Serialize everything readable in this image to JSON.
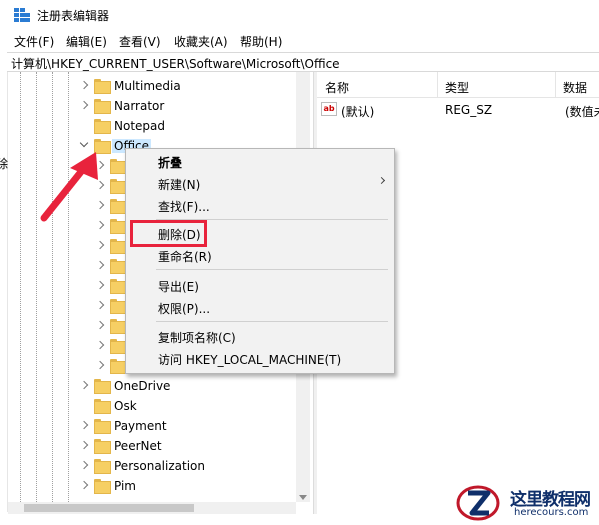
{
  "window": {
    "title": "注册表编辑器"
  },
  "menu": [
    "文件(F)",
    "编辑(E)",
    "查看(V)",
    "收藏夹(A)",
    "帮助(H)"
  ],
  "address": "计算机\\HKEY_CURRENT_USER\\Software\\Microsoft\\Office",
  "left_edge_char": "除",
  "tree": {
    "above": [
      "Multimedia",
      "Narrator",
      "Notepad"
    ],
    "selected": "Office",
    "below": [
      "OneDrive",
      "Osk",
      "Payment",
      "PeerNet",
      "Personalization",
      "Pim"
    ]
  },
  "columns": [
    "名称",
    "类型",
    "数据"
  ],
  "values": [
    {
      "icon": "ab",
      "name": "(默认)",
      "type": "REG_SZ",
      "data": "(数值未"
    }
  ],
  "context_menu": {
    "items": [
      {
        "label": "折叠",
        "bold": true
      },
      {
        "label": "新建(N)",
        "submenu": true
      },
      {
        "label": "查找(F)..."
      },
      {
        "separator": true
      },
      {
        "label": "删除(D)"
      },
      {
        "label": "重命名(R)"
      },
      {
        "separator": true
      },
      {
        "label": "导出(E)"
      },
      {
        "label": "权限(P)..."
      },
      {
        "separator": true
      },
      {
        "label": "复制项名称(C)"
      },
      {
        "label": "访问 HKEY_LOCAL_MACHINE(T)"
      }
    ]
  },
  "watermark": {
    "title": "这里教程网",
    "url": "herecours.com"
  },
  "colors": {
    "annotation": "#e8233c",
    "selection": "#cce8ff",
    "folder": "#f6cf64"
  }
}
